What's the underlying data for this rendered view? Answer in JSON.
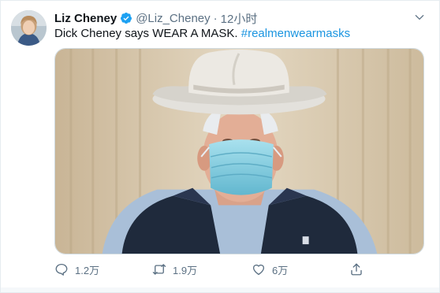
{
  "tweet": {
    "author_name": "Liz Cheney",
    "handle": "@Liz_Cheney",
    "separator": "·",
    "time": "12小时",
    "verified": true,
    "text_plain": "Dick Cheney says WEAR A MASK. ",
    "hashtag": "#realmenwearmasks"
  },
  "actions": {
    "reply_count": "1.2万",
    "retweet_count": "1.9万",
    "like_count": "6万"
  },
  "colors": {
    "accent": "#1b95e0",
    "verified": "#1da1f2",
    "muted": "#5b7083"
  },
  "icons": {
    "verified": "verified-badge-icon",
    "more": "chevron-down-icon",
    "reply": "reply-icon",
    "retweet": "retweet-icon",
    "like": "heart-icon",
    "share": "share-icon"
  }
}
